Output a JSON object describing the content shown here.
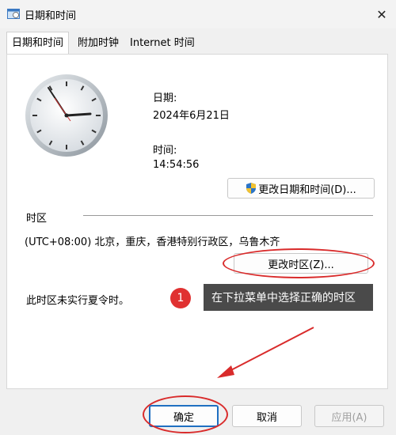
{
  "window": {
    "title": "日期和时间",
    "close_glyph": "✕"
  },
  "tabs": [
    {
      "label": "日期和时间",
      "active": true
    },
    {
      "label": "附加时钟",
      "active": false
    },
    {
      "label": "Internet 时间",
      "active": false
    }
  ],
  "datetime": {
    "date_label": "日期:",
    "date_value": "2024年6月21日",
    "time_label": "时间:",
    "time_value": "14:54:56",
    "change_button": "更改日期和时间(D)..."
  },
  "timezone": {
    "section_label": "时区",
    "value": "(UTC+08:00) 北京，重庆，香港特别行政区，乌鲁木齐",
    "change_button": "更改时区(Z)...",
    "dst_note": "此时区未实行夏令时。"
  },
  "annotation": {
    "badge_number": "1",
    "tooltip_text": "在下拉菜单中选择正确的时区",
    "color": "#e03131"
  },
  "footer": {
    "ok": "确定",
    "cancel": "取消",
    "apply": "应用(A)"
  },
  "icons": {
    "app": "calendar-clock-icon",
    "shield": "uac-shield-icon",
    "clock": "analog-clock-icon"
  }
}
